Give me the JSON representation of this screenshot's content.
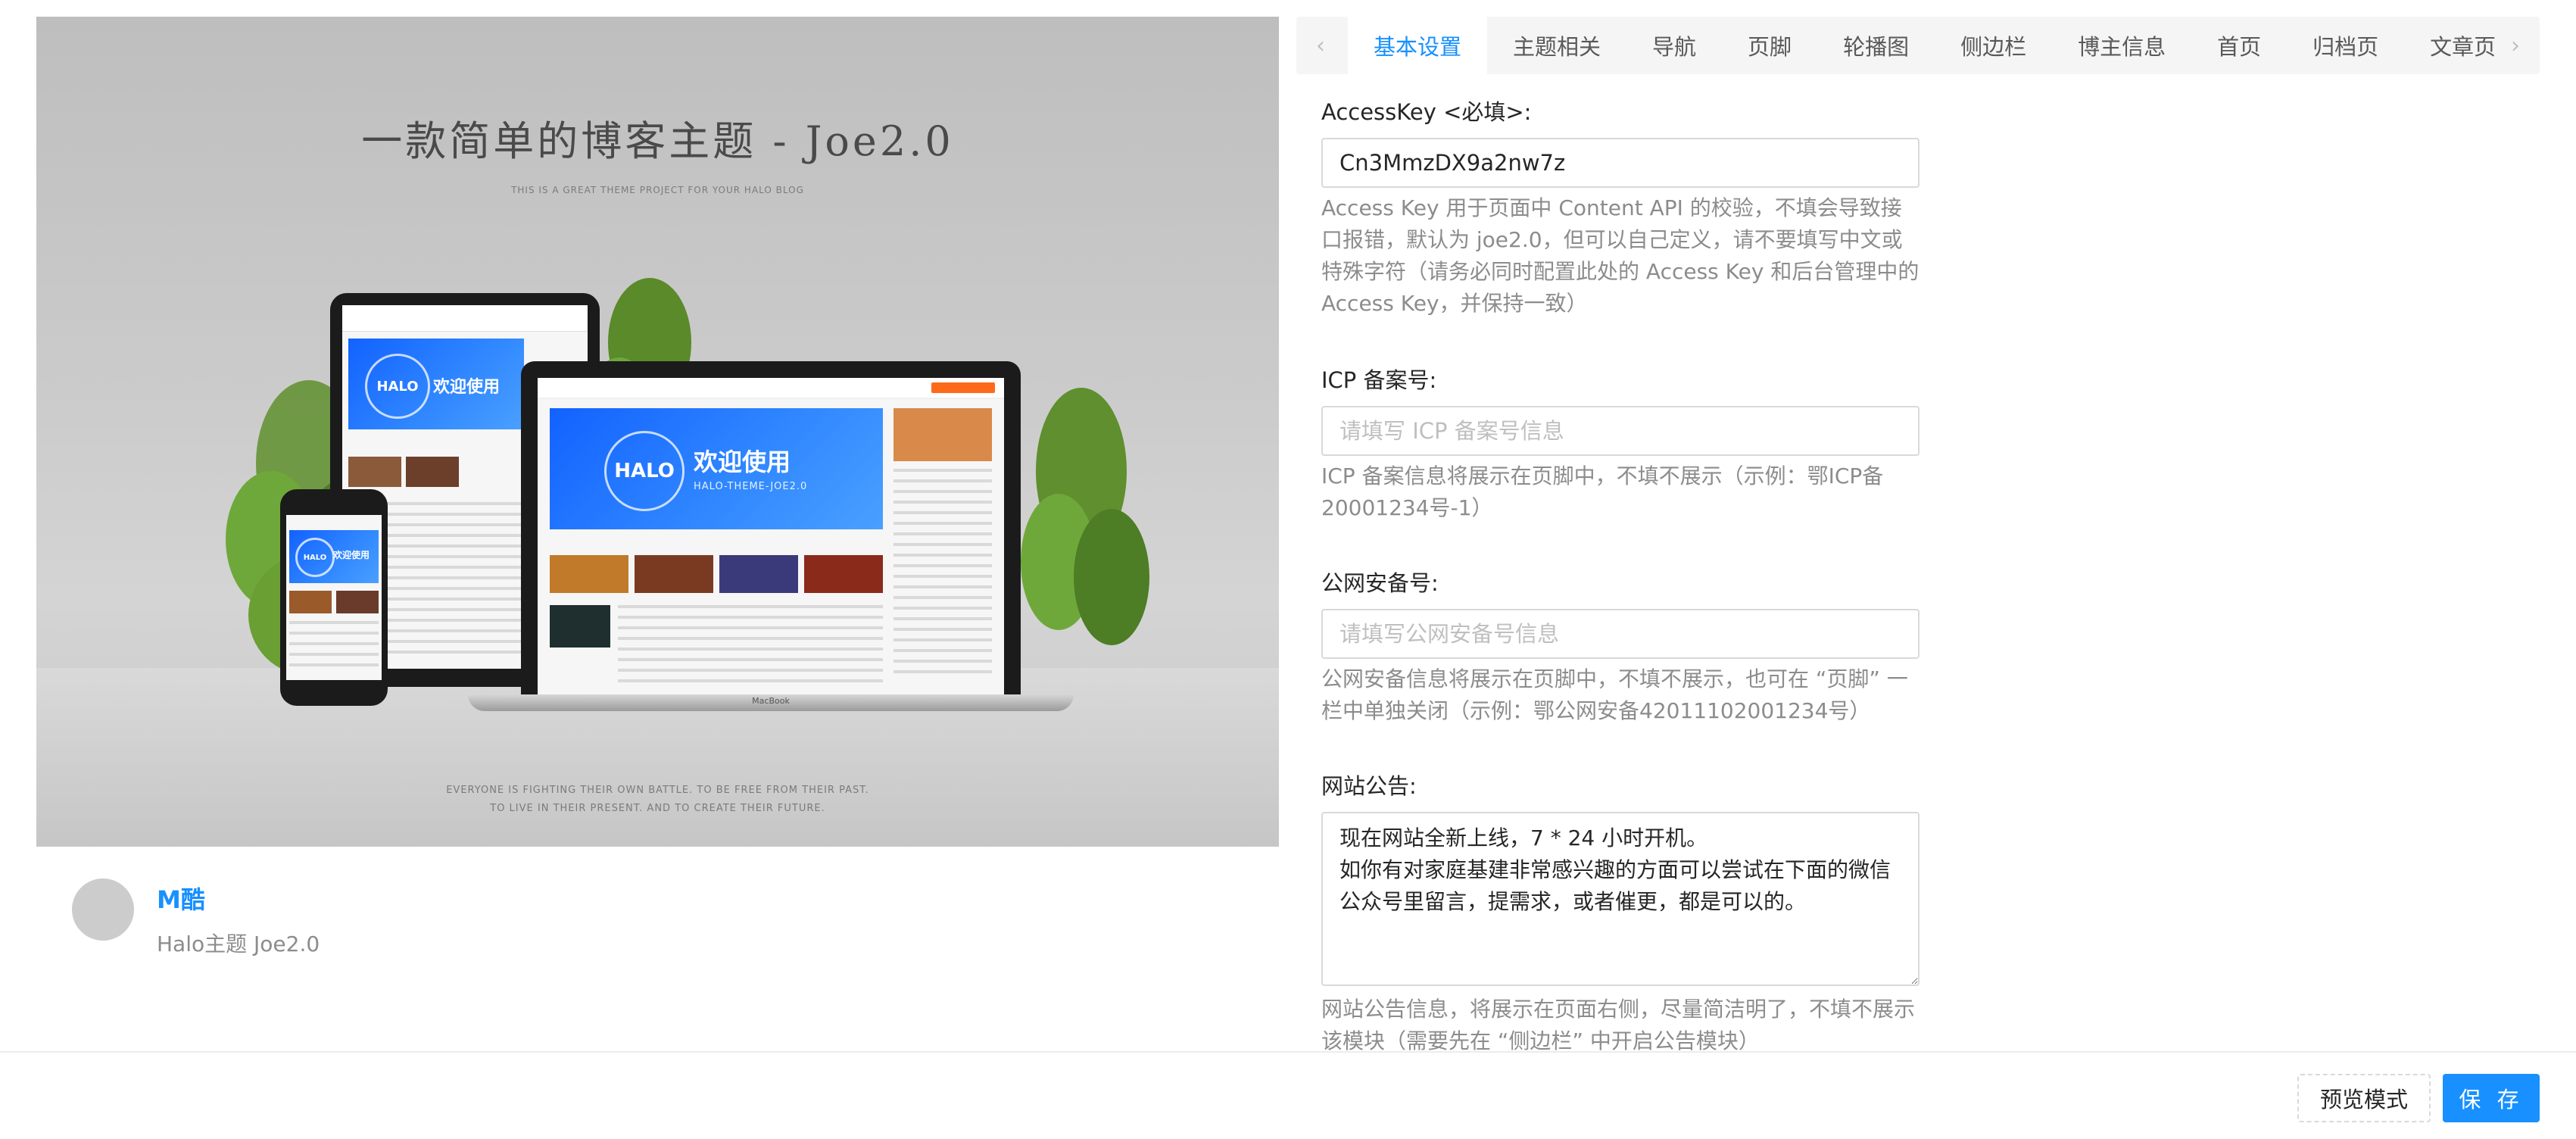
{
  "preview": {
    "headline": "一款简单的博客主题 - Joe2.0",
    "subline": "THIS IS A GREAT THEME PROJECT FOR YOUR HALO BLOG",
    "footline_1": "EVERYONE IS FIGHTING THEIR OWN BATTLE. TO BE FREE FROM THEIR PAST.",
    "footline_2": "TO LIVE IN THEIR PRESENT. AND TO CREATE THEIR FUTURE.",
    "banner_logo": "HALO",
    "banner_title": "欢迎使用",
    "banner_subtitle": "HALO-THEME-JOE2.0",
    "laptop_brand": "MacBook"
  },
  "author": {
    "name": "M酷",
    "description": "Halo主题 Joe2.0"
  },
  "tabs": {
    "items": [
      "基本设置",
      "主题相关",
      "导航",
      "页脚",
      "轮播图",
      "侧边栏",
      "博主信息",
      "首页",
      "归档页",
      "文章页"
    ],
    "active_index": 0
  },
  "form": {
    "access_key": {
      "label": "AccessKey <必填>:",
      "value": "Cn3MmzDX9a2nw7z",
      "help": "Access Key 用于页面中 Content API 的校验，不填会导致接口报错，默认为 joe2.0，但可以自己定义，请不要填写中文或特殊字符（请务必同时配置此处的 Access Key 和后台管理中的 Access Key，并保持一致）"
    },
    "icp": {
      "label": "ICP 备案号:",
      "placeholder": "请填写 ICP 备案号信息",
      "help": "ICP 备案信息将展示在页脚中，不填不展示（示例：鄂ICP备20001234号-1）"
    },
    "police": {
      "label": "公网安备号:",
      "placeholder": "请填写公网安备号信息",
      "help": "公网安备信息将展示在页脚中，不填不展示，也可在 “页脚” 一栏中单独关闭（示例：鄂公网安备42011102001234号）"
    },
    "notice": {
      "label": "网站公告:",
      "value": "现在网站全新上线，7 * 24 小时开机。\n如你有对家庭基建非常感兴趣的方面可以尝试在下面的微信公众号里留言，提需求，或者催更，都是可以的。",
      "help": "网站公告信息，将展示在页面右侧，尽量简洁明了，不填不展示该模块（需要先在 “侧边栏” 中开启公告模块）"
    }
  },
  "footer": {
    "preview_label": "预览模式",
    "save_label": "保 存"
  },
  "colors": {
    "accent": "#1890ff",
    "tabs_bg": "#f5f5f5",
    "help_text": "#8c8c8c"
  }
}
